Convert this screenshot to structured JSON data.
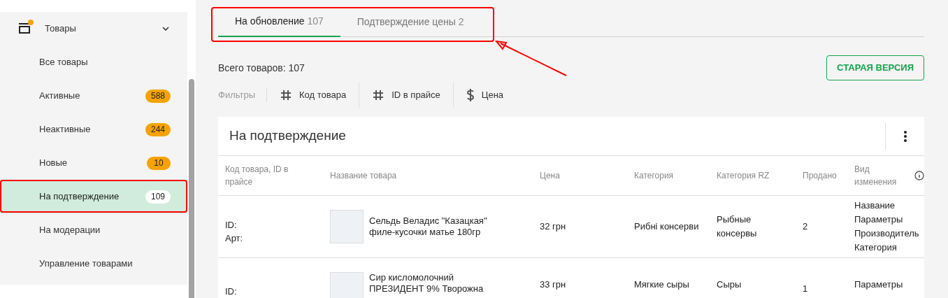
{
  "sidebar": {
    "section": {
      "label": "Товары",
      "expanded": true,
      "has_notification": true
    },
    "items": [
      {
        "label": "Все товары",
        "selected": false
      },
      {
        "label": "Активные",
        "count": "588",
        "selected": false
      },
      {
        "label": "Неактивные",
        "count": "244",
        "selected": false
      },
      {
        "label": "Новые",
        "count": "10",
        "selected": false
      },
      {
        "label": "На подтверждение",
        "count": "109",
        "selected": true
      },
      {
        "label": "На модерации",
        "selected": false
      },
      {
        "label": "Управление товарами",
        "selected": false
      }
    ]
  },
  "tabs": [
    {
      "label": "На обновление",
      "count": "107",
      "selected": true
    },
    {
      "label": "Подтверждение цены",
      "count": "2",
      "selected": false
    }
  ],
  "total": "Всего товаров: 107",
  "old_version_button": "СТАРАЯ ВЕРСИЯ",
  "filters": {
    "label": "Фильтры",
    "items": [
      {
        "kind": "hash",
        "label": "Код товара"
      },
      {
        "kind": "hash",
        "label": "ID в прайсе"
      },
      {
        "kind": "dollar",
        "label": "Цена"
      }
    ]
  },
  "table": {
    "title": "На подтверждение",
    "columns": [
      "Код товара, ID в прайсе",
      "Название товара",
      "Цена",
      "Категория",
      "Категория RZ",
      "Продано",
      "Вид изменения"
    ],
    "rows": [
      {
        "codes": [
          "ID:",
          "Арт:"
        ],
        "name": "Сельдь Веладис \"Казацкая\" филе-кусочки матье 180гр",
        "price": "32 грн",
        "category": "Рибні консерви",
        "category_rz": "Рыбные консервы",
        "sold": "2",
        "changes": [
          "Название",
          "Параметры",
          "Производитель",
          "Категория"
        ]
      },
      {
        "codes": [
          "ID:"
        ],
        "name": "Сир кисломолочний ПРЕЗИДЕНТ 9% Творожна",
        "price": "33 грн",
        "category": "Мягкие сыры",
        "category_rz": "Сыры",
        "sold": "1",
        "changes": [
          "Параметры"
        ]
      }
    ]
  }
}
